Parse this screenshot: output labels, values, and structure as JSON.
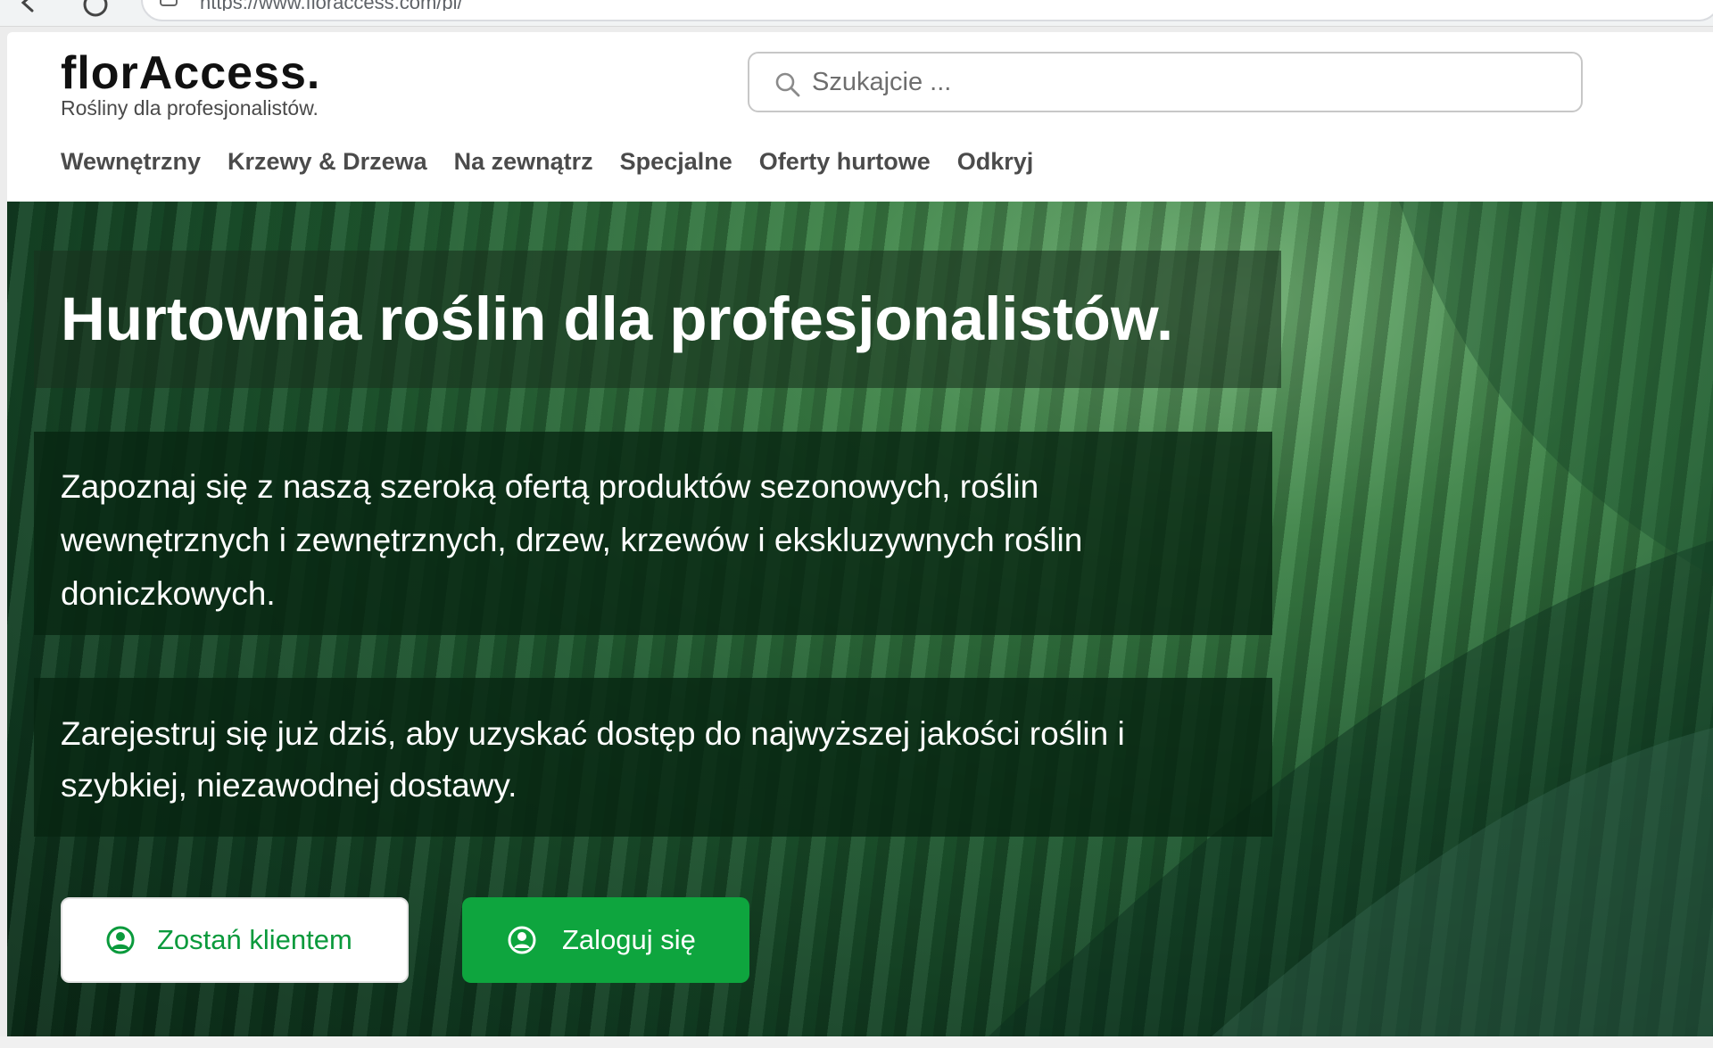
{
  "browser": {
    "url": "https://www.floraccess.com/pl/"
  },
  "header": {
    "logo_text": "florAccess.",
    "tagline": "Rośliny dla profesjonalistów.",
    "search_placeholder": "Szukajcie ..."
  },
  "nav": {
    "items": [
      {
        "label": "Wewnętrzny"
      },
      {
        "label": "Krzewy & Drzewa"
      },
      {
        "label": "Na zewnątrz"
      },
      {
        "label": "Specjalne"
      },
      {
        "label": "Oferty hurtowe"
      },
      {
        "label": "Odkryj"
      }
    ]
  },
  "hero": {
    "title": "Hurtownia roślin dla profesjonalistów.",
    "paragraph1": "Zapoznaj się z naszą szeroką ofertą produktów sezonowych, roślin wewnętrznych i zewnętrznych, drzew, krzewów i ekskluzywnych roślin doniczkowych.",
    "paragraph2": "Zarejestruj się już dziś, aby uzyskać dostęp do najwyższej jakości roślin i szybkiej, niezawodnej dostawy.",
    "register_button": "Zostań klientem",
    "login_button": "Zaloguj się"
  },
  "colors": {
    "brand_green": "#0ea53e",
    "register_text": "#0a9a3c",
    "nav_text": "#4b4b4b"
  },
  "icons": {
    "back": "arrow-left-icon",
    "reload": "reload-icon",
    "site": "site-info-icon",
    "search": "search-icon",
    "register": "user-add-icon",
    "login": "user-circle-icon"
  }
}
